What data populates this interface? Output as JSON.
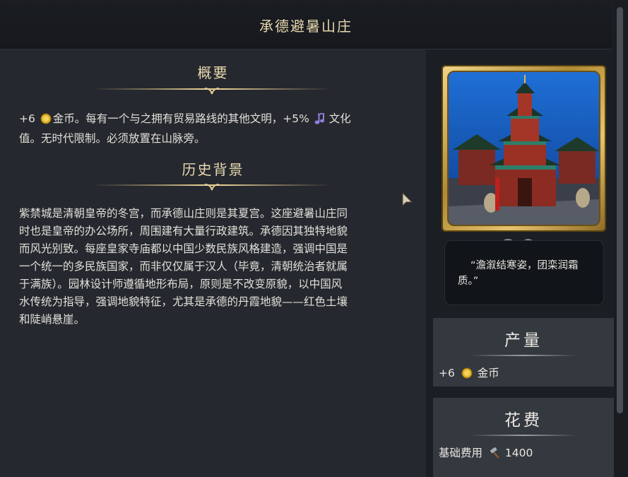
{
  "window": {
    "title": "承德避暑山庄"
  },
  "summary": {
    "heading": "概要",
    "line1_prefix": "+6",
    "line1_gold": "金币。每有一个与之拥有贸易路线的其他文明，+5%",
    "line1_culture": "文化",
    "line2": "值。无时代限制。必须放置在山脉旁。",
    "gold_icon": "gold-coin-icon",
    "culture_icon": "music-note-icon"
  },
  "history": {
    "heading": "历史背景",
    "lines": [
      "紫禁城是清朝皇帝的冬宫，而承德山庄则是其夏宫。这座避暑山庄同",
      "时也是皇帝的办公场所，周围建有大量行政建筑。承德因其独特地貌",
      "而风光别致。每座皇家寺庙都以中国少数民族风格建造，强调中国是",
      "一个统一的多民族国家，而非仅仅属于汉人（毕竟，清朝统治者就属",
      "于满族）。园林设计师遵循地形布局，原则是不改变原貌，以中国风",
      "水传统为指导，强调地貌特征，尤其是承德的丹霞地貌——红色土壤",
      "和陡峭悬崖。"
    ]
  },
  "quote": {
    "text": "“澹溆结寒姿，团栾润霜质。”"
  },
  "yield": {
    "heading": "产量",
    "value": "+6",
    "label": "金币",
    "icon": "gold-coin-icon"
  },
  "cost": {
    "heading": "花费",
    "label": "基础费用",
    "value": "1400",
    "icon": "hammer-icon"
  },
  "colors": {
    "heading_gold": "#e8d9b0",
    "panel_bg": "#25282e",
    "info_box_bg": "#34383f",
    "frame_gold": "#d4b05a"
  }
}
